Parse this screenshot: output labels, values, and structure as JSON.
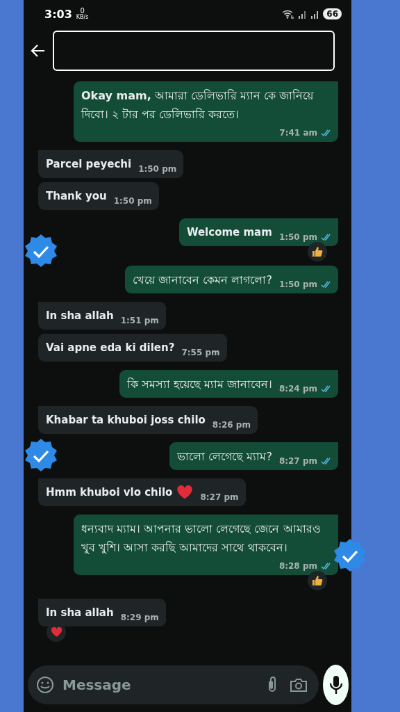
{
  "status_bar": {
    "time": "3:03",
    "speed_value": "0",
    "speed_unit": "KB/s",
    "battery": "66"
  },
  "header": {
    "redacted": true
  },
  "messages": [
    {
      "kind": "outgoing",
      "text": "**Okay mam,** আমারা ডেলিভারি ম্যান কে জানিয়ে দিবো। ২ টার পর ডেলিভারি করতে।",
      "bold": false,
      "time": "7:41 am",
      "read": true
    },
    {
      "kind": "incoming",
      "text": "Parcel peyechi",
      "bold": true,
      "time": "1:50 pm"
    },
    {
      "kind": "incoming",
      "text": "Thank you",
      "bold": true,
      "time": "1:50 pm"
    },
    {
      "kind": "outgoing",
      "text": "Welcome mam",
      "bold": true,
      "time": "1:50 pm",
      "read": true,
      "reaction": {
        "kind": "thumbs-up"
      },
      "badge_left": true
    },
    {
      "kind": "outgoing",
      "text": "খেয়ে জানাবেন কেমন লাগলো?",
      "bold": false,
      "time": "1:50 pm",
      "read": true
    },
    {
      "kind": "incoming",
      "text": "In sha allah",
      "bold": true,
      "time": "1:51 pm"
    },
    {
      "kind": "incoming",
      "text": "Vai apne eda ki dilen?",
      "bold": true,
      "time": "7:55 pm"
    },
    {
      "kind": "outgoing",
      "text": "কি সমস্যা হয়েছে ম্যাম জানাবেন।",
      "bold": false,
      "time": "8:24 pm",
      "read": true
    },
    {
      "kind": "incoming",
      "text": "Khabar ta khuboi joss chilo",
      "bold": true,
      "time": "8:26 pm"
    },
    {
      "kind": "outgoing",
      "text": "ভালো লেগেছে ম্যাম?",
      "bold": false,
      "time": "8:27 pm",
      "read": true,
      "badge_left": true
    },
    {
      "kind": "incoming",
      "text": "Hmm khuboi vlo chilo",
      "bold": true,
      "emoji": {
        "kind": "heart"
      },
      "time": "8:27 pm"
    },
    {
      "kind": "outgoing",
      "text": "ধন্যবাদ ম্যাম। আপনার ভালো লেগেছে জেনে আমারও খুব খুশি। আসা করছি আমাদের সাথে থাকবেন।",
      "bold": false,
      "time": "8:28 pm",
      "read": true,
      "reaction": {
        "kind": "thumbs-up"
      },
      "badge_right": true
    },
    {
      "kind": "incoming",
      "text": "In sha allah",
      "bold": true,
      "time": "8:29 pm",
      "reaction": {
        "kind": "heart"
      }
    }
  ],
  "composer": {
    "placeholder": "Message"
  }
}
